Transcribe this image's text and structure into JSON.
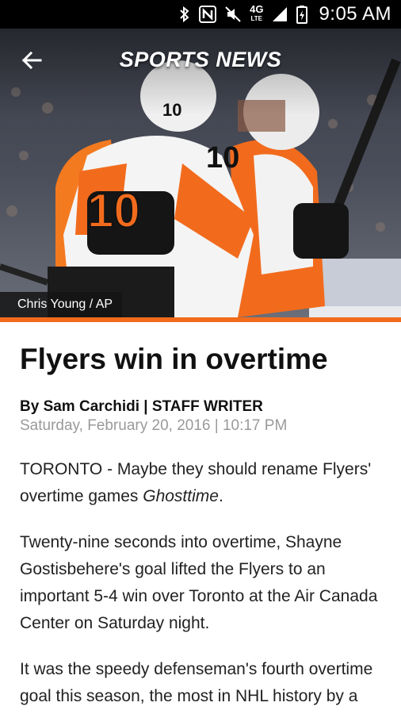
{
  "status_bar": {
    "network": "4G",
    "network_sub": "LTE",
    "time": "9:05 AM"
  },
  "app_bar": {
    "title": "SPORTS NEWS",
    "back_icon": "arrow-back-icon"
  },
  "hero": {
    "photo_credit": "Chris Young / AP",
    "accent_color": "#f26b1d",
    "jersey_number": "10"
  },
  "article": {
    "headline": "Flyers win in overtime",
    "byline": "By Sam Carchidi | STAFF WRITER",
    "dateline": "Saturday, February 20, 2016 | 10:17 PM",
    "paragraph_1_text": "TORONTO - Maybe they should rename Flyers' overtime games ",
    "paragraph_1_emphasis": "Ghosttime",
    "paragraph_1_end": ".",
    "paragraph_2": "Twenty-nine seconds into overtime, Shayne Gostisbehere's goal lifted the Flyers to an important 5-4 win over Toronto at the Air Canada Center on Saturday night.",
    "paragraph_3": "It was the speedy defenseman's fourth overtime goal this season, the most in NHL history by a rookie."
  }
}
